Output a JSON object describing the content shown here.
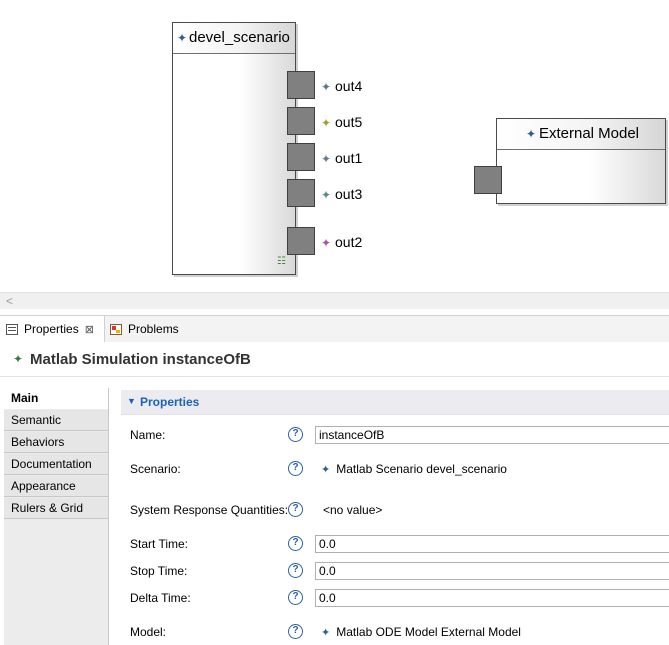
{
  "diagram": {
    "blocks": [
      {
        "title": "devel_scenario",
        "icon": "scenario-star-icon"
      },
      {
        "title": "External Model",
        "icon": "model-star-icon"
      }
    ],
    "ports": [
      {
        "label": "out4",
        "color": "#5a7a8a"
      },
      {
        "label": "out5",
        "color": "#a79a3a"
      },
      {
        "label": "out1",
        "color": "#6a7a88"
      },
      {
        "label": "out3",
        "color": "#5a8a8a"
      },
      {
        "label": "out2",
        "color": "#a05aa0"
      }
    ],
    "model_icon": "hierarchy-icon"
  },
  "scrollbar": {
    "left_arrow": "<"
  },
  "view_tabs": [
    {
      "label": "Properties",
      "icon": "properties-icon",
      "close": "⊠"
    },
    {
      "label": "Problems",
      "icon": "problems-icon"
    }
  ],
  "properties": {
    "title": "Matlab Simulation instanceOfB",
    "title_icon": "simulation-star-icon",
    "side_tabs": [
      "Main",
      "Semantic",
      "Behaviors",
      "Documentation",
      "Appearance",
      "Rulers & Grid"
    ],
    "active_tab": "Main",
    "section_title": "Properties",
    "fields": {
      "name": {
        "label": "Name:",
        "value": "instanceOfB"
      },
      "scenario": {
        "label": "Scenario:",
        "value": "Matlab Scenario devel_scenario"
      },
      "srq": {
        "label": "System Response Quantities:",
        "value": "<no value>"
      },
      "start": {
        "label": "Start Time:",
        "value": "0.0"
      },
      "stop": {
        "label": "Stop Time:",
        "value": "0.0"
      },
      "delta": {
        "label": "Delta Time:",
        "value": "0.0"
      },
      "model": {
        "label": "Model:",
        "value": "Matlab ODE Model External Model"
      }
    },
    "help_glyph": "?"
  },
  "colors": {
    "accent": "#1b63b6",
    "port_fill": "#808080"
  }
}
